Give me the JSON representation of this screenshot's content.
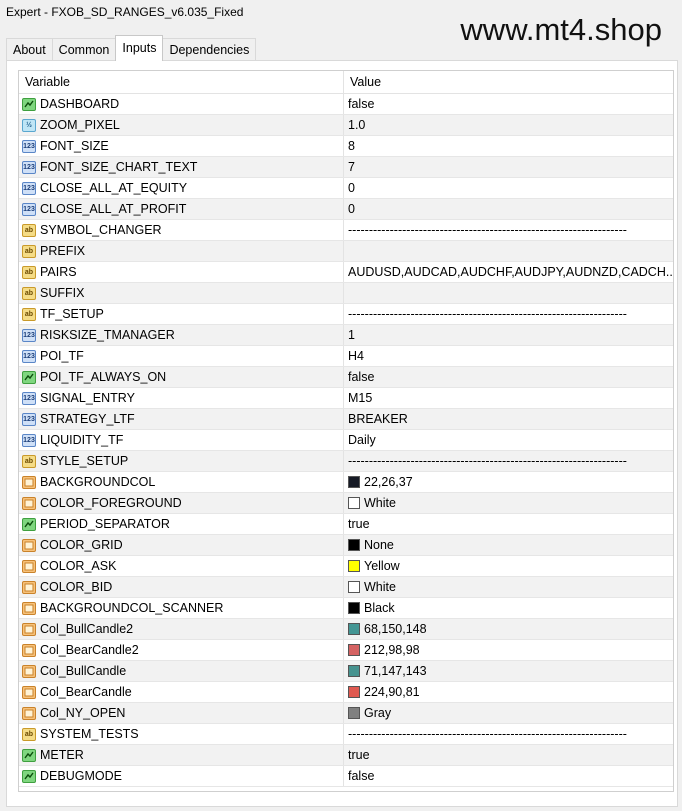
{
  "window": {
    "title": "Expert - FXOB_SD_RANGES_v6.035_Fixed"
  },
  "watermark": "www.mt4.shop",
  "tabs": [
    {
      "label": "About",
      "active": false
    },
    {
      "label": "Common",
      "active": false
    },
    {
      "label": "Inputs",
      "active": true
    },
    {
      "label": "Dependencies",
      "active": false
    }
  ],
  "table": {
    "headers": {
      "variable": "Variable",
      "value": "Value"
    },
    "rows": [
      {
        "name": "DASHBOARD",
        "type": "bool",
        "value": "false"
      },
      {
        "name": "ZOOM_PIXEL",
        "type": "double",
        "value": "1.0"
      },
      {
        "name": "FONT_SIZE",
        "type": "int",
        "value": "8"
      },
      {
        "name": "FONT_SIZE_CHART_TEXT",
        "type": "int",
        "value": "7"
      },
      {
        "name": "CLOSE_ALL_AT_EQUITY",
        "type": "int",
        "value": "0"
      },
      {
        "name": "CLOSE_ALL_AT_PROFIT",
        "type": "int",
        "value": "0"
      },
      {
        "name": "SYMBOL_CHANGER",
        "type": "string",
        "value": "-------------------------------------------------------------------"
      },
      {
        "name": "PREFIX",
        "type": "string",
        "value": ""
      },
      {
        "name": "PAIRS",
        "type": "string",
        "value": "AUDUSD,AUDCAD,AUDCHF,AUDJPY,AUDNZD,CADCH..."
      },
      {
        "name": "SUFFIX",
        "type": "string",
        "value": ""
      },
      {
        "name": "TF_SETUP",
        "type": "string",
        "value": "-------------------------------------------------------------------"
      },
      {
        "name": "RISKSIZE_TMANAGER",
        "type": "int",
        "value": "1"
      },
      {
        "name": "POI_TF",
        "type": "int",
        "value": "H4"
      },
      {
        "name": "POI_TF_ALWAYS_ON",
        "type": "bool",
        "value": "false"
      },
      {
        "name": "SIGNAL_ENTRY",
        "type": "int",
        "value": "M15"
      },
      {
        "name": "STRATEGY_LTF",
        "type": "int",
        "value": "BREAKER"
      },
      {
        "name": "LIQUIDITY_TF",
        "type": "int",
        "value": "Daily"
      },
      {
        "name": "STYLE_SETUP",
        "type": "string",
        "value": "-------------------------------------------------------------------"
      },
      {
        "name": "BACKGROUNDCOL",
        "type": "color",
        "value": "22,26,37",
        "swatch": "#161a25"
      },
      {
        "name": "COLOR_FOREGROUND",
        "type": "color",
        "value": "White",
        "swatch": "#ffffff"
      },
      {
        "name": "PERIOD_SEPARATOR",
        "type": "bool",
        "value": "true"
      },
      {
        "name": "COLOR_GRID",
        "type": "color",
        "value": "None",
        "swatch": "#000000"
      },
      {
        "name": "COLOR_ASK",
        "type": "color",
        "value": "Yellow",
        "swatch": "#ffff00"
      },
      {
        "name": "COLOR_BID",
        "type": "color",
        "value": "White",
        "swatch": "#ffffff"
      },
      {
        "name": "BACKGROUNDCOL_SCANNER",
        "type": "color",
        "value": "Black",
        "swatch": "#000000"
      },
      {
        "name": "Col_BullCandle2",
        "type": "color",
        "value": "68,150,148",
        "swatch": "#449694"
      },
      {
        "name": "Col_BearCandle2",
        "type": "color",
        "value": "212,98,98",
        "swatch": "#d46262"
      },
      {
        "name": "Col_BullCandle",
        "type": "color",
        "value": "71,147,143",
        "swatch": "#47938f"
      },
      {
        "name": "Col_BearCandle",
        "type": "color",
        "value": "224,90,81",
        "swatch": "#e05a51"
      },
      {
        "name": "Col_NY_OPEN",
        "type": "color",
        "value": "Gray",
        "swatch": "#808080"
      },
      {
        "name": "SYSTEM_TESTS",
        "type": "string",
        "value": "-------------------------------------------------------------------"
      },
      {
        "name": "METER",
        "type": "bool",
        "value": "true"
      },
      {
        "name": "DEBUGMODE",
        "type": "bool",
        "value": "false"
      }
    ]
  },
  "icons": {
    "bool": {
      "name": "bool-type-icon"
    },
    "double": {
      "name": "double-type-icon"
    },
    "int": {
      "name": "int-type-icon"
    },
    "string": {
      "name": "string-type-icon"
    },
    "color": {
      "name": "color-type-icon"
    }
  }
}
